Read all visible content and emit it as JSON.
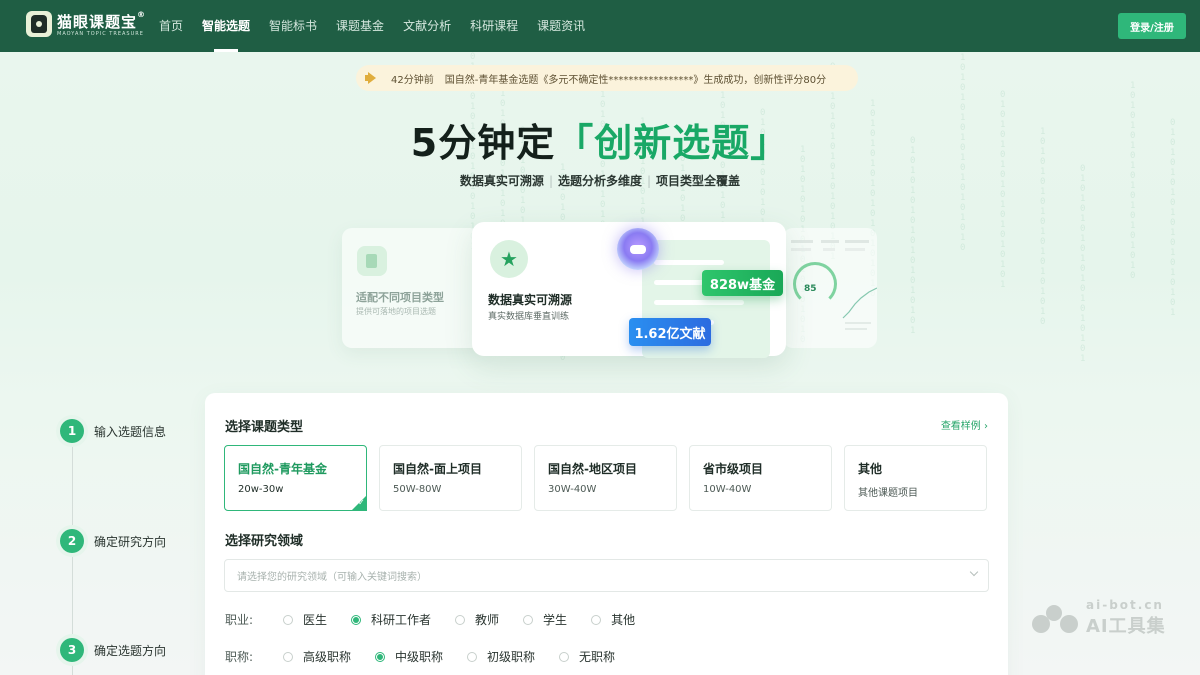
{
  "brand": {
    "name": "猫眼课题宝",
    "registered": "®",
    "tagline": "MAOYAN TOPIC TREASURE"
  },
  "nav": {
    "items": [
      "首页",
      "智能选题",
      "智能标书",
      "课题基金",
      "文献分析",
      "科研课程",
      "课题资讯"
    ],
    "active_index": 1,
    "login_label": "登录/注册"
  },
  "notice": {
    "time": "42分钟前",
    "text": "国自然-青年基金选题《多元不确定性*****************》生成成功，创新性评分80分"
  },
  "hero": {
    "title_prefix": "5分钟定",
    "title_highlight": "「创新选题」",
    "sub_1": "数据真实可溯源",
    "sub_2": "选题分析多维度",
    "sub_3": "项目类型全覆盖",
    "separator": "|"
  },
  "features": {
    "left": {
      "title": "适配不同项目类型",
      "desc": "提供可落地的项目选题"
    },
    "main": {
      "title": "数据真实可溯源",
      "desc": "真实数据库垂直训练",
      "icon": "star-badge-icon"
    },
    "right": {
      "score": "85"
    },
    "badge_fund": "828w基金",
    "badge_literature": "1.62亿文献"
  },
  "steps": [
    {
      "num": "1",
      "label": "输入选题信息"
    },
    {
      "num": "2",
      "label": "确定研究方向"
    },
    {
      "num": "3",
      "label": "确定选题方向"
    }
  ],
  "form": {
    "type_section_title": "选择课题类型",
    "sample_link": "查看样例 ›",
    "types": [
      {
        "name": "国自然-青年基金",
        "range": "20w-30w",
        "selected": true
      },
      {
        "name": "国自然-面上项目",
        "range": "50W-80W",
        "selected": false
      },
      {
        "name": "国自然-地区项目",
        "range": "30W-40W",
        "selected": false
      },
      {
        "name": "省市级项目",
        "range": "10W-40W",
        "selected": false
      },
      {
        "name": "其他",
        "range": "其他课题项目",
        "selected": false
      }
    ],
    "field_section_title": "选择研究领域",
    "field_placeholder": "请选择您的研究领域（可输入关键词搜索）",
    "occupation": {
      "label": "职业:",
      "options": [
        "医生",
        "科研工作者",
        "教师",
        "学生",
        "其他"
      ],
      "selected_index": 1
    },
    "title_rank": {
      "label": "职称:",
      "options": [
        "高级职称",
        "中级职称",
        "初级职称",
        "无职称"
      ],
      "selected_index": 1
    }
  },
  "watermark": {
    "line1": "ai-bot.cn",
    "line2": "AI工具集"
  },
  "colors": {
    "nav_bg": "#1f5e44",
    "accent": "#2fb77a",
    "highlight_text": "#19a866",
    "fund_badge": "#1aa857",
    "literature_badge": "#2c6be0"
  }
}
